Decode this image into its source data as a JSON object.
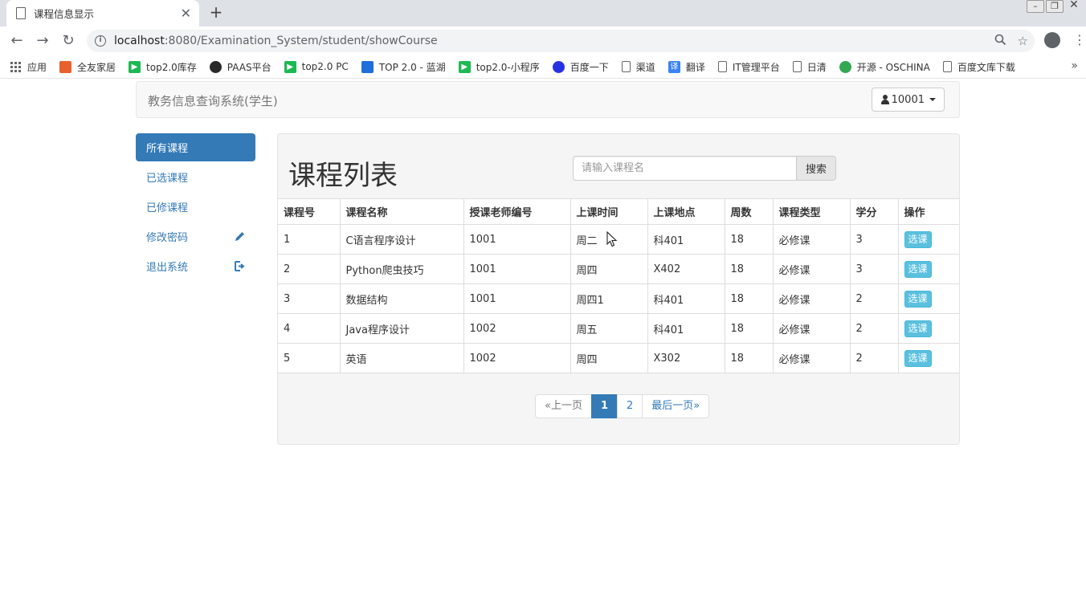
{
  "browser": {
    "tab_title": "课程信息显示",
    "url_host": "localhost",
    "url_path": ":8080/Examination_System/student/showCourse",
    "bookmarks": [
      {
        "label": "应用",
        "icon": "apps-grid-icon"
      },
      {
        "label": "全友家居",
        "icon": "quanyou-logo-icon",
        "color": "#e8612c"
      },
      {
        "label": "top2.0库存",
        "icon": "green-play-icon",
        "color": "#1db954"
      },
      {
        "label": "PAAS平台",
        "icon": "paas-logo-icon",
        "color": "#2a2a2a"
      },
      {
        "label": "top2.0 PC",
        "icon": "green-play-icon",
        "color": "#1db954"
      },
      {
        "label": "TOP 2.0 - 蓝湖",
        "icon": "lanhu-logo-icon",
        "color": "#1e6fd9"
      },
      {
        "label": "top2.0-小程序",
        "icon": "green-play-icon",
        "color": "#1db954"
      },
      {
        "label": "百度一下",
        "icon": "baidu-paw-icon",
        "color": "#2932e1"
      },
      {
        "label": "渠道",
        "icon": "document-icon"
      },
      {
        "label": "翻译",
        "icon": "translate-icon",
        "color": "#3b82f6"
      },
      {
        "label": "IT管理平台",
        "icon": "document-icon"
      },
      {
        "label": "日清",
        "icon": "document-icon"
      },
      {
        "label": "开源 - OSCHINA",
        "icon": "oschina-logo-icon",
        "color": "#33a853"
      },
      {
        "label": "百度文库下载",
        "icon": "document-icon"
      }
    ]
  },
  "navbar": {
    "brand": "教务信息查询系统(学生)",
    "user": "10001"
  },
  "sidebar": {
    "items": [
      {
        "label": "所有课程",
        "active": true
      },
      {
        "label": "已选课程"
      },
      {
        "label": "已修课程"
      },
      {
        "label": "修改密码",
        "icon": "pencil-icon"
      },
      {
        "label": "退出系统",
        "icon": "logout-icon"
      }
    ]
  },
  "main": {
    "heading": "课程列表",
    "search": {
      "placeholder": "请输入课程名",
      "value": "",
      "button": "搜索"
    },
    "table": {
      "headers": [
        "课程号",
        "课程名称",
        "授课老师编号",
        "上课时间",
        "上课地点",
        "周数",
        "课程类型",
        "学分",
        "操作"
      ],
      "rows": [
        [
          "1",
          "C语言程序设计",
          "1001",
          "周二",
          "科401",
          "18",
          "必修课",
          "3",
          "选课"
        ],
        [
          "2",
          "Python爬虫技巧",
          "1001",
          "周四",
          "X402",
          "18",
          "必修课",
          "3",
          "选课"
        ],
        [
          "3",
          "数据结构",
          "1001",
          "周四1",
          "科401",
          "18",
          "必修课",
          "2",
          "选课"
        ],
        [
          "4",
          "Java程序设计",
          "1002",
          "周五",
          "科401",
          "18",
          "必修课",
          "2",
          "选课"
        ],
        [
          "5",
          "英语",
          "1002",
          "周四",
          "X302",
          "18",
          "必修课",
          "2",
          "选课"
        ]
      ]
    },
    "pagination": {
      "prev": "«上一页",
      "pages": [
        "1",
        "2"
      ],
      "current": "1",
      "last": "最后一页»"
    }
  }
}
